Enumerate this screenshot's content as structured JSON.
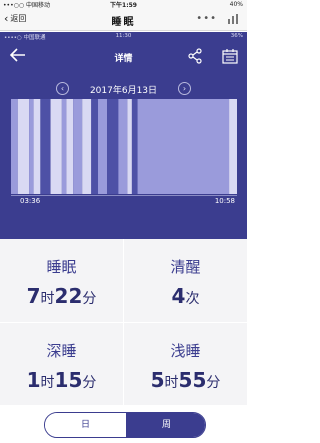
{
  "os_status": {
    "carrier": "•••○○ 中国移动",
    "time": "下午1:59",
    "battery": "40%"
  },
  "outer_nav": {
    "back_label": "返回",
    "title": "睡眠",
    "more_icon": "more-dots-icon",
    "chart_icon": "bar-chart-icon"
  },
  "inner_status": {
    "carrier": "••••○ 中国联通",
    "time": "11:30",
    "battery": "36%"
  },
  "inner_nav": {
    "title": "详情",
    "back_icon": "arrow-left-icon",
    "share_icon": "share-icon",
    "calendar_icon": "calendar-icon"
  },
  "date_nav": {
    "date": "2017年6月13日",
    "prev_label": "‹",
    "next_label": "›"
  },
  "chart_data": {
    "type": "bar",
    "title": "",
    "x_start_label": "03:36",
    "x_end_label": "10:58",
    "legend": [],
    "stage_colors": {
      "deep": "#4e51a6",
      "light": "#9a9bdb",
      "awake": "#d9d9f3"
    },
    "segments": [
      {
        "stage": "light",
        "start": 0.0,
        "end": 0.03
      },
      {
        "stage": "awake",
        "start": 0.03,
        "end": 0.08
      },
      {
        "stage": "light",
        "start": 0.08,
        "end": 0.1
      },
      {
        "stage": "awake",
        "start": 0.1,
        "end": 0.13
      },
      {
        "stage": "deep",
        "start": 0.13,
        "end": 0.175
      },
      {
        "stage": "awake",
        "start": 0.175,
        "end": 0.225
      },
      {
        "stage": "light",
        "start": 0.225,
        "end": 0.245
      },
      {
        "stage": "awake",
        "start": 0.245,
        "end": 0.275
      },
      {
        "stage": "light",
        "start": 0.275,
        "end": 0.315
      },
      {
        "stage": "awake",
        "start": 0.315,
        "end": 0.355
      },
      {
        "stage": "deep",
        "start": 0.355,
        "end": 0.385
      },
      {
        "stage": "light",
        "start": 0.385,
        "end": 0.425
      },
      {
        "stage": "deep",
        "start": 0.425,
        "end": 0.475
      },
      {
        "stage": "light",
        "start": 0.475,
        "end": 0.515
      },
      {
        "stage": "awake",
        "start": 0.515,
        "end": 0.535
      },
      {
        "stage": "deep",
        "start": 0.535,
        "end": 0.56
      },
      {
        "stage": "light",
        "start": 0.56,
        "end": 0.965
      },
      {
        "stage": "awake",
        "start": 0.965,
        "end": 1.0
      }
    ]
  },
  "stats": {
    "sleep": {
      "label": "睡眠",
      "hours": "7",
      "hours_unit": "时",
      "minutes": "22",
      "minutes_unit": "分"
    },
    "awake": {
      "label": "清醒",
      "count": "4",
      "count_unit": "次"
    },
    "deep": {
      "label": "深睡",
      "hours": "1",
      "hours_unit": "时",
      "minutes": "15",
      "minutes_unit": "分"
    },
    "light": {
      "label": "浅睡",
      "hours": "5",
      "hours_unit": "时",
      "minutes": "55",
      "minutes_unit": "分"
    }
  },
  "tabs": {
    "day": "日",
    "week": "周"
  },
  "colors": {
    "accent": "#3b3d8f",
    "stats_bg": "#f4f4f6"
  }
}
